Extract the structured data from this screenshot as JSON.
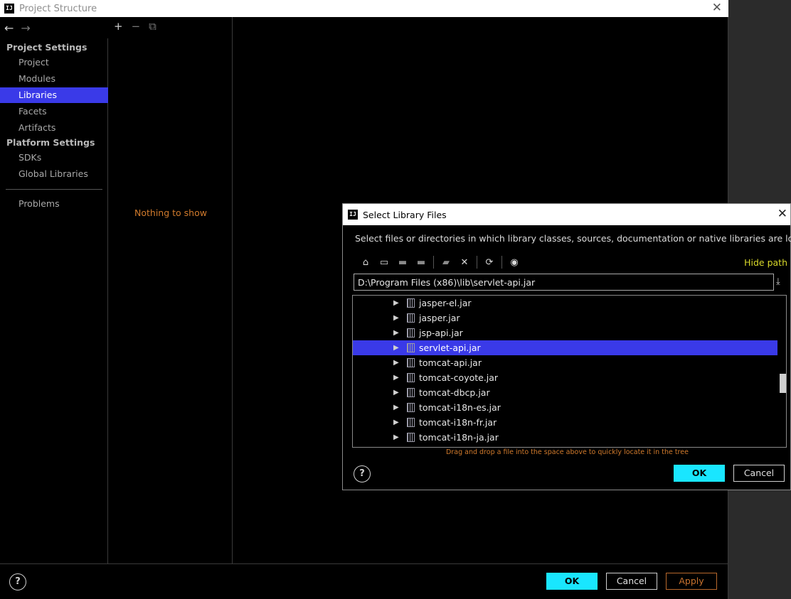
{
  "main_window": {
    "title": "Project Structure",
    "close_glyph": "✕",
    "nav": {
      "back_icon": "arrow-left-icon",
      "forward_icon": "arrow-right-icon",
      "back_glyph": "←",
      "forward_glyph": "→"
    },
    "sidebar": {
      "project_settings_heading": "Project Settings",
      "project_items": [
        "Project",
        "Modules",
        "Libraries",
        "Facets",
        "Artifacts"
      ],
      "platform_settings_heading": "Platform Settings",
      "platform_items": [
        "SDKs",
        "Global Libraries"
      ],
      "problems": "Problems",
      "selected": "Libraries"
    },
    "library_panel": {
      "add_glyph": "+",
      "remove_glyph": "−",
      "copy_glyph": "⧉",
      "empty_text": "Nothing to show"
    },
    "footer": {
      "help": "?",
      "ok": "OK",
      "cancel": "Cancel",
      "apply": "Apply"
    }
  },
  "dialog": {
    "title": "Select Library Files",
    "close_glyph": "✕",
    "description": "Select files or directories in which library classes, sources, documentation or native libraries are located",
    "toolbar": {
      "home_glyph": "⌂",
      "desktop_glyph": "▭",
      "project_glyph": "▬",
      "module_glyph": "▬",
      "new_folder_glyph": "▰",
      "delete_glyph": "✕",
      "refresh_glyph": "⟳",
      "show_hidden_glyph": "◉"
    },
    "hide_path": "Hide path",
    "path_value": "D:\\Program Files (x86)\\lib\\servlet-api.jar",
    "download_glyph": "⤓",
    "tree_items": [
      "jasper-el.jar",
      "jasper.jar",
      "jsp-api.jar",
      "servlet-api.jar",
      "tomcat-api.jar",
      "tomcat-coyote.jar",
      "tomcat-dbcp.jar",
      "tomcat-i18n-es.jar",
      "tomcat-i18n-fr.jar",
      "tomcat-i18n-ja.jar"
    ],
    "selected_item": "servlet-api.jar",
    "expand_glyph": "▶",
    "drag_hint": "Drag and drop a file into the space above to quickly locate it in the tree",
    "footer": {
      "help": "?",
      "ok": "OK",
      "cancel": "Cancel"
    }
  },
  "colors": {
    "selection": "#3a3ae8",
    "primary_button": "#19e6ff",
    "warning_text": "#d07a2c",
    "hide_path_link": "#d9d92a"
  }
}
